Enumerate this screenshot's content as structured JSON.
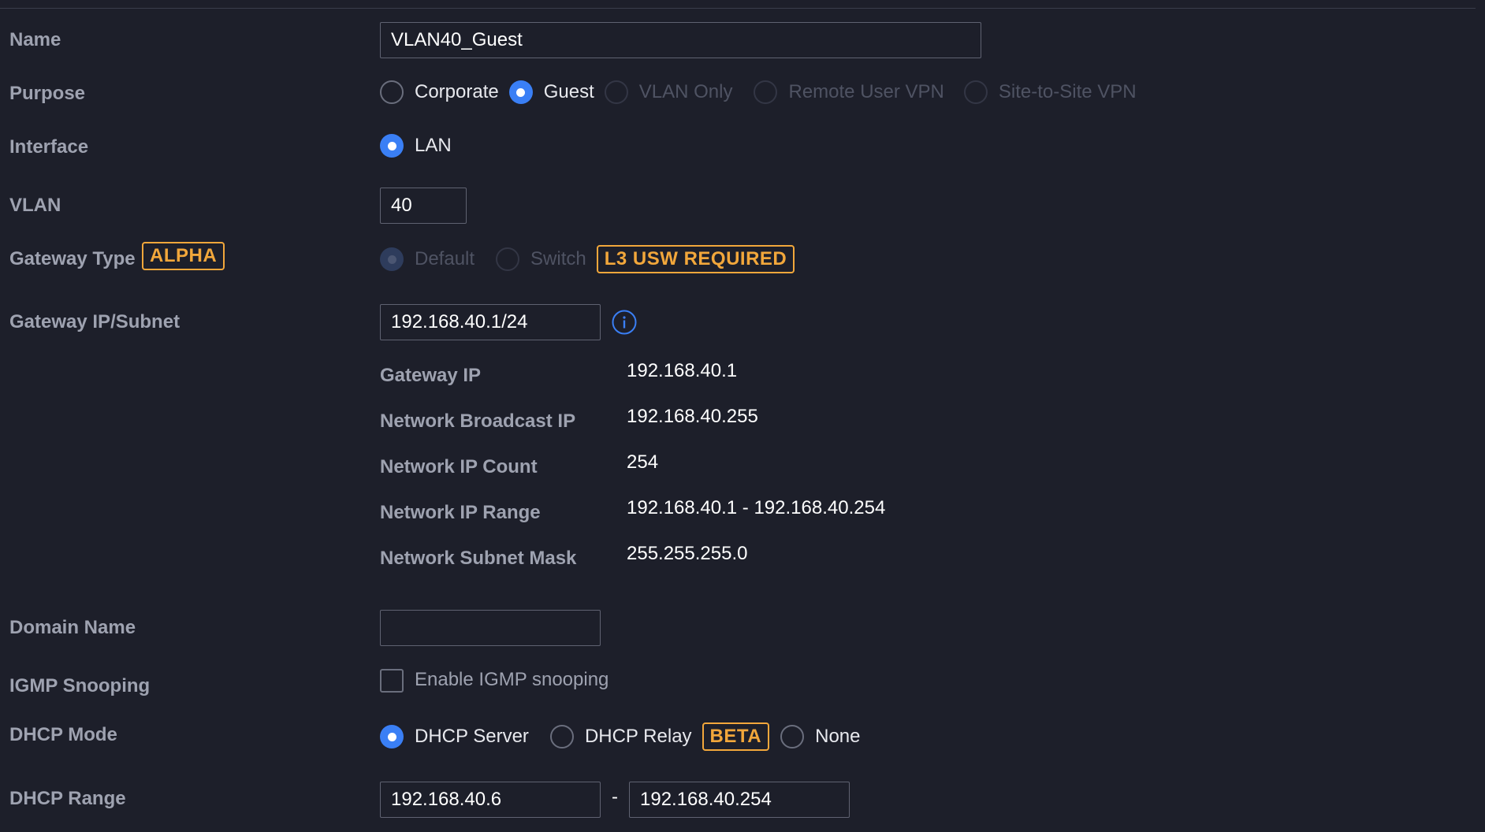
{
  "fields": {
    "name": {
      "label": "Name",
      "value": "VLAN40_Guest"
    },
    "purpose": {
      "label": "Purpose",
      "options": [
        "Corporate",
        "Guest",
        "VLAN Only",
        "Remote User VPN",
        "Site-to-Site VPN"
      ],
      "selected": "Guest"
    },
    "interface": {
      "label": "Interface",
      "options": [
        "LAN"
      ],
      "selected": "LAN"
    },
    "vlan": {
      "label": "VLAN",
      "value": "40"
    },
    "gateway_type": {
      "label": "Gateway Type",
      "badge": "ALPHA",
      "options": [
        "Default",
        "Switch"
      ],
      "selected": "Default",
      "requirement_badge": "L3 USW REQUIRED"
    },
    "gateway_subnet": {
      "label": "Gateway IP/Subnet",
      "value": "192.168.40.1/24"
    },
    "details": [
      {
        "label": "Gateway IP",
        "value": "192.168.40.1"
      },
      {
        "label": "Network Broadcast IP",
        "value": "192.168.40.255"
      },
      {
        "label": "Network IP Count",
        "value": "254"
      },
      {
        "label": "Network IP Range",
        "value": "192.168.40.1 - 192.168.40.254"
      },
      {
        "label": "Network Subnet Mask",
        "value": "255.255.255.0"
      }
    ],
    "domain_name": {
      "label": "Domain Name",
      "value": ""
    },
    "igmp": {
      "label": "IGMP Snooping",
      "checkbox_label": "Enable IGMP snooping",
      "checked": false
    },
    "dhcp_mode": {
      "label": "DHCP Mode",
      "options": [
        "DHCP Server",
        "DHCP Relay",
        "None"
      ],
      "relay_badge": "BETA",
      "selected": "DHCP Server"
    },
    "dhcp_range": {
      "label": "DHCP Range",
      "start": "192.168.40.6",
      "separator": "-",
      "end": "192.168.40.254"
    }
  },
  "icons": {
    "info": "info-circle-icon"
  },
  "colors": {
    "accent": "#3a7ff5",
    "badge": "#f2a73b",
    "background": "#1d1f2a"
  }
}
